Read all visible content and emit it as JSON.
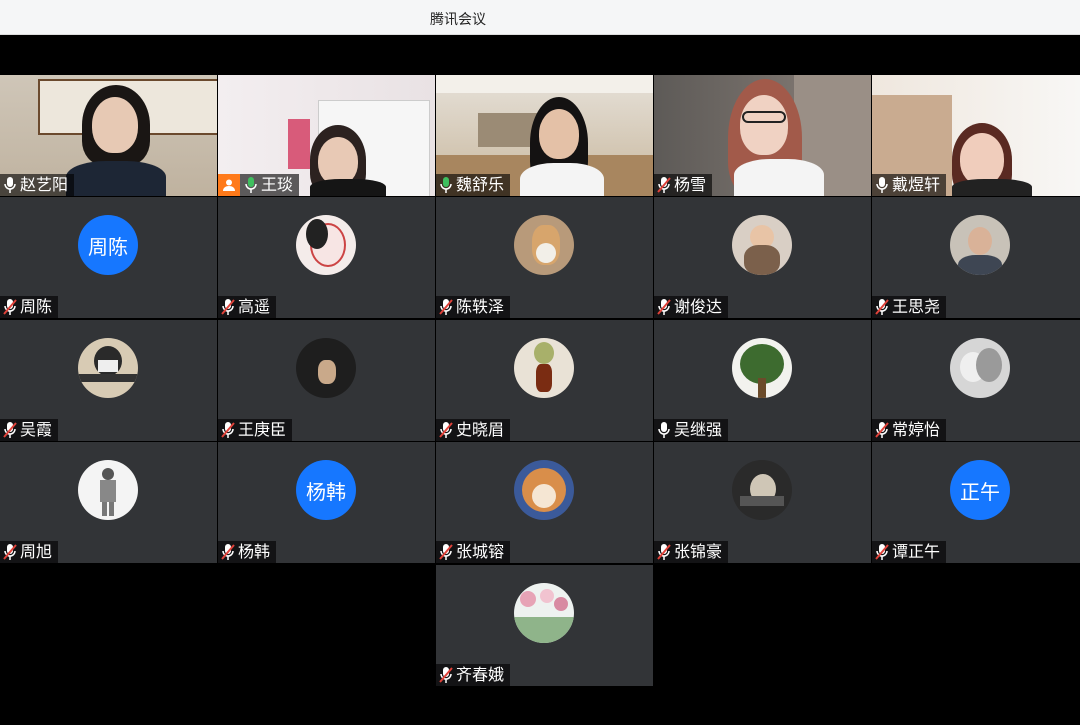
{
  "window": {
    "title": "腾讯会议"
  },
  "participants": [
    {
      "name": "赵艺阳",
      "mic": "on"
    },
    {
      "name": "王琰",
      "mic": "on-green",
      "host": true
    },
    {
      "name": "魏舒乐",
      "mic": "on-green"
    },
    {
      "name": "杨雪",
      "mic": "muted"
    },
    {
      "name": "戴煜轩",
      "mic": "on"
    },
    {
      "name": "周陈",
      "mic": "muted",
      "avatar_text": "周陈"
    },
    {
      "name": "高遥",
      "mic": "muted"
    },
    {
      "name": "陈轶泽",
      "mic": "muted"
    },
    {
      "name": "谢俊达",
      "mic": "muted"
    },
    {
      "name": "王思尧",
      "mic": "muted"
    },
    {
      "name": "吴霞",
      "mic": "muted"
    },
    {
      "name": "王庚臣",
      "mic": "muted"
    },
    {
      "name": "史晓眉",
      "mic": "muted"
    },
    {
      "name": "吴继强",
      "mic": "on"
    },
    {
      "name": "常婷怡",
      "mic": "muted"
    },
    {
      "name": "周旭",
      "mic": "muted"
    },
    {
      "name": "杨韩",
      "mic": "muted",
      "avatar_text": "杨韩"
    },
    {
      "name": "张城镕",
      "mic": "muted"
    },
    {
      "name": "张锦豪",
      "mic": "muted"
    },
    {
      "name": "谭正午",
      "mic": "muted",
      "avatar_text": "正午"
    },
    {
      "name": "齐春娥",
      "mic": "muted"
    }
  ],
  "colors": {
    "accent": "#1677ff",
    "host_badge": "#ff7a1a",
    "speaking": "#3fbf5f",
    "muted": "#e0423a"
  }
}
